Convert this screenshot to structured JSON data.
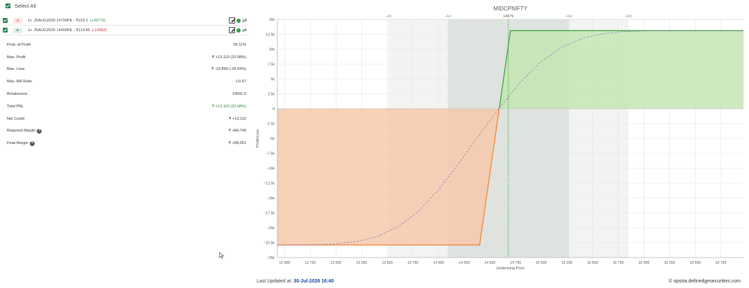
{
  "select_all": {
    "label": "Select All"
  },
  "legs": [
    {
      "side": "S",
      "qty": "1x",
      "contract": "25AUG2026 14700PE",
      "price": "- ₹223.1",
      "pnl": "(+26772)",
      "pnl_sign": "pos"
    },
    {
      "side": "B",
      "qty": "1x",
      "contract": "25AUG2026 14400PE",
      "price": "- ₹113.85",
      "pnl": "(-13662)",
      "pnl_sign": "neg"
    }
  ],
  "metrics": [
    {
      "label": "Prob. of Profit",
      "value": "56.11%",
      "help": false,
      "green": false
    },
    {
      "label": "Max. Profit",
      "value": "₹ +13,110 (22.58%)",
      "help": false,
      "green": false
    },
    {
      "label": "Max. Loss",
      "value": "₹ -22,890 (-39.43%)",
      "help": false,
      "green": false
    },
    {
      "label": "Max. RR Ratio",
      "value": "1:0.57",
      "help": false,
      "green": false
    },
    {
      "label": "Breakevens",
      "value": "14591.0",
      "help": false,
      "green": false
    },
    {
      "label": "Total PNL",
      "value": "₹ +13,110 (22.58%)",
      "help": false,
      "green": true
    },
    {
      "label": "Net Credit",
      "value": "₹ +13,110",
      "help": false,
      "green": false
    },
    {
      "label": "Required Margin",
      "value": "₹ +84,749",
      "help": true,
      "green": false
    },
    {
      "label": "Final Margin",
      "value": "₹ +58,051",
      "help": true,
      "green": false
    }
  ],
  "chart_data": {
    "type": "area",
    "title": "MIDCPNIFTY",
    "xlabel": "Underlying Price",
    "ylabel": "Profit/Loss",
    "xlim": [
      12430,
      16970
    ],
    "ylim": [
      -25000,
      15000
    ],
    "x_ticks": [
      12500,
      12750,
      13000,
      13250,
      13500,
      13750,
      14000,
      14250,
      14500,
      14750,
      15000,
      15250,
      15500,
      15750,
      16000,
      16250,
      16500,
      16750
    ],
    "x_tick_labels": [
      "12 500",
      "12 750",
      "13 000",
      "13 250",
      "13 500",
      "13 750",
      "14 000",
      "14 250",
      "14 500",
      "14 750",
      "15 000",
      "15 250",
      "15 500",
      "15 750",
      "16 000",
      "16 250",
      "16 500",
      "16 750"
    ],
    "y_ticks": [
      15000,
      12500,
      10000,
      7500,
      5000,
      2500,
      0,
      -2500,
      -5000,
      -7500,
      -10000,
      -12500,
      -15000,
      -17500,
      -20000,
      -22500,
      -25000
    ],
    "y_tick_labels": [
      "15k",
      "12.5k",
      "10k",
      "7.5k",
      "5k",
      "2.5k",
      "0",
      "−2.5k",
      "−5k",
      "−7.5k",
      "−10k",
      "−12.5k",
      "−15k",
      "−17.5k",
      "−20k",
      "−22.5k",
      "−25k"
    ],
    "payoff": [
      [
        12430,
        -22890
      ],
      [
        14400,
        -22890
      ],
      [
        14700,
        13110
      ],
      [
        16970,
        13110
      ]
    ],
    "expected_curve": [
      [
        12430,
        -22890
      ],
      [
        12800,
        -22850
      ],
      [
        13000,
        -22700
      ],
      [
        13200,
        -22300
      ],
      [
        13400,
        -21500
      ],
      [
        13600,
        -19900
      ],
      [
        13800,
        -17300
      ],
      [
        14000,
        -13600
      ],
      [
        14200,
        -9100
      ],
      [
        14400,
        -4300
      ],
      [
        14600,
        300
      ],
      [
        14800,
        4500
      ],
      [
        15000,
        7900
      ],
      [
        15200,
        10300
      ],
      [
        15400,
        11800
      ],
      [
        15600,
        12600
      ],
      [
        15800,
        12950
      ],
      [
        16000,
        13060
      ],
      [
        16400,
        13110
      ],
      [
        16970,
        13110
      ]
    ],
    "spot": {
      "value": 14679,
      "label": "14679"
    },
    "sigma_bands": [
      {
        "label": "−2σ",
        "from": 13510,
        "to": 15850
      },
      {
        "label": "−1σ",
        "from": 14090,
        "to": 15270
      },
      {
        "label": "+1σ",
        "value": 15270
      },
      {
        "label": "+2σ",
        "value": 15850
      }
    ],
    "colors": {
      "profit_line": "#2ca02c",
      "profit_fill": "#c6e5b3",
      "loss_line": "#f07f2f",
      "loss_fill": "#f6c9ab",
      "curve": "#8a7fbf",
      "spot": "#3aa34a",
      "band1": "#dfe3df",
      "band2": "#f2f4f2"
    }
  },
  "footer": {
    "updated_label": "Last Updated at:",
    "updated_value": "30-Jul-2026 16:40",
    "credit": "© opstra.definedgesecurities.com"
  }
}
